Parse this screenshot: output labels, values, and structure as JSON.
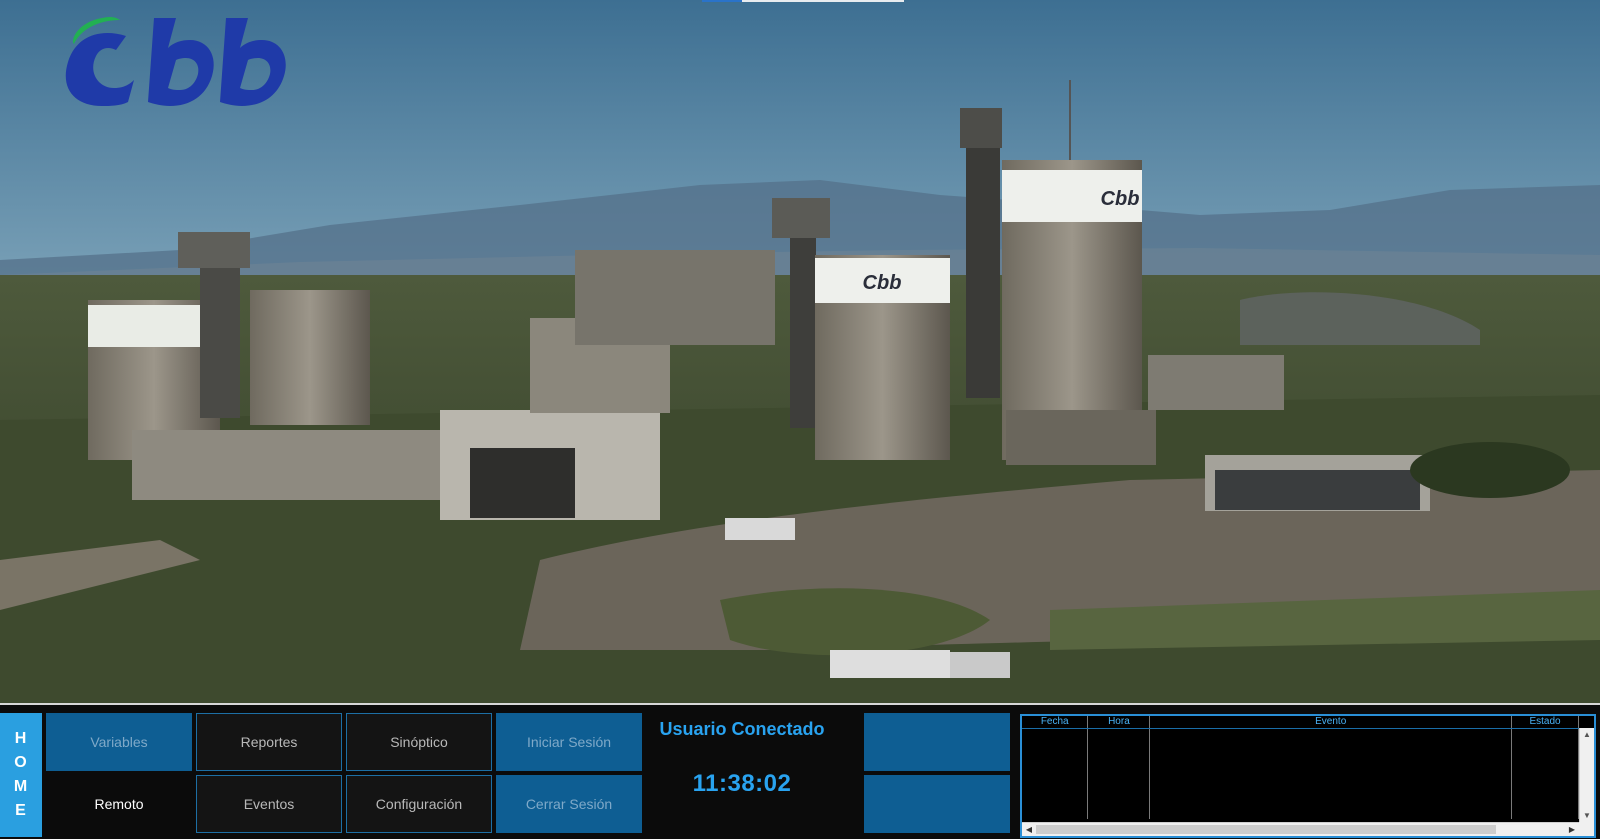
{
  "app": {
    "brand_logo_text": "Cbb"
  },
  "scene": {
    "silo_brand_text": "Cbb"
  },
  "home": {
    "letters": [
      "H",
      "O",
      "M",
      "E"
    ]
  },
  "nav": {
    "variables": "Variables",
    "remote": "Remoto",
    "reports": "Reportes",
    "events": "Eventos",
    "synoptic": "Sinóptico",
    "configuration": "Configuración",
    "login": "Iniciar Sesión",
    "logout": "Cerrar Sesión"
  },
  "session": {
    "user_label": "Usuario Conectado",
    "clock": "11:38:02"
  },
  "event_table": {
    "columns": [
      "Fecha",
      "Hora",
      "Evento",
      "Estado"
    ],
    "rows": []
  },
  "colors": {
    "accent": "#29a3f0",
    "button_blue": "#0e5e93",
    "brand_blue": "#1f3aa8",
    "brand_green": "#22b052"
  }
}
